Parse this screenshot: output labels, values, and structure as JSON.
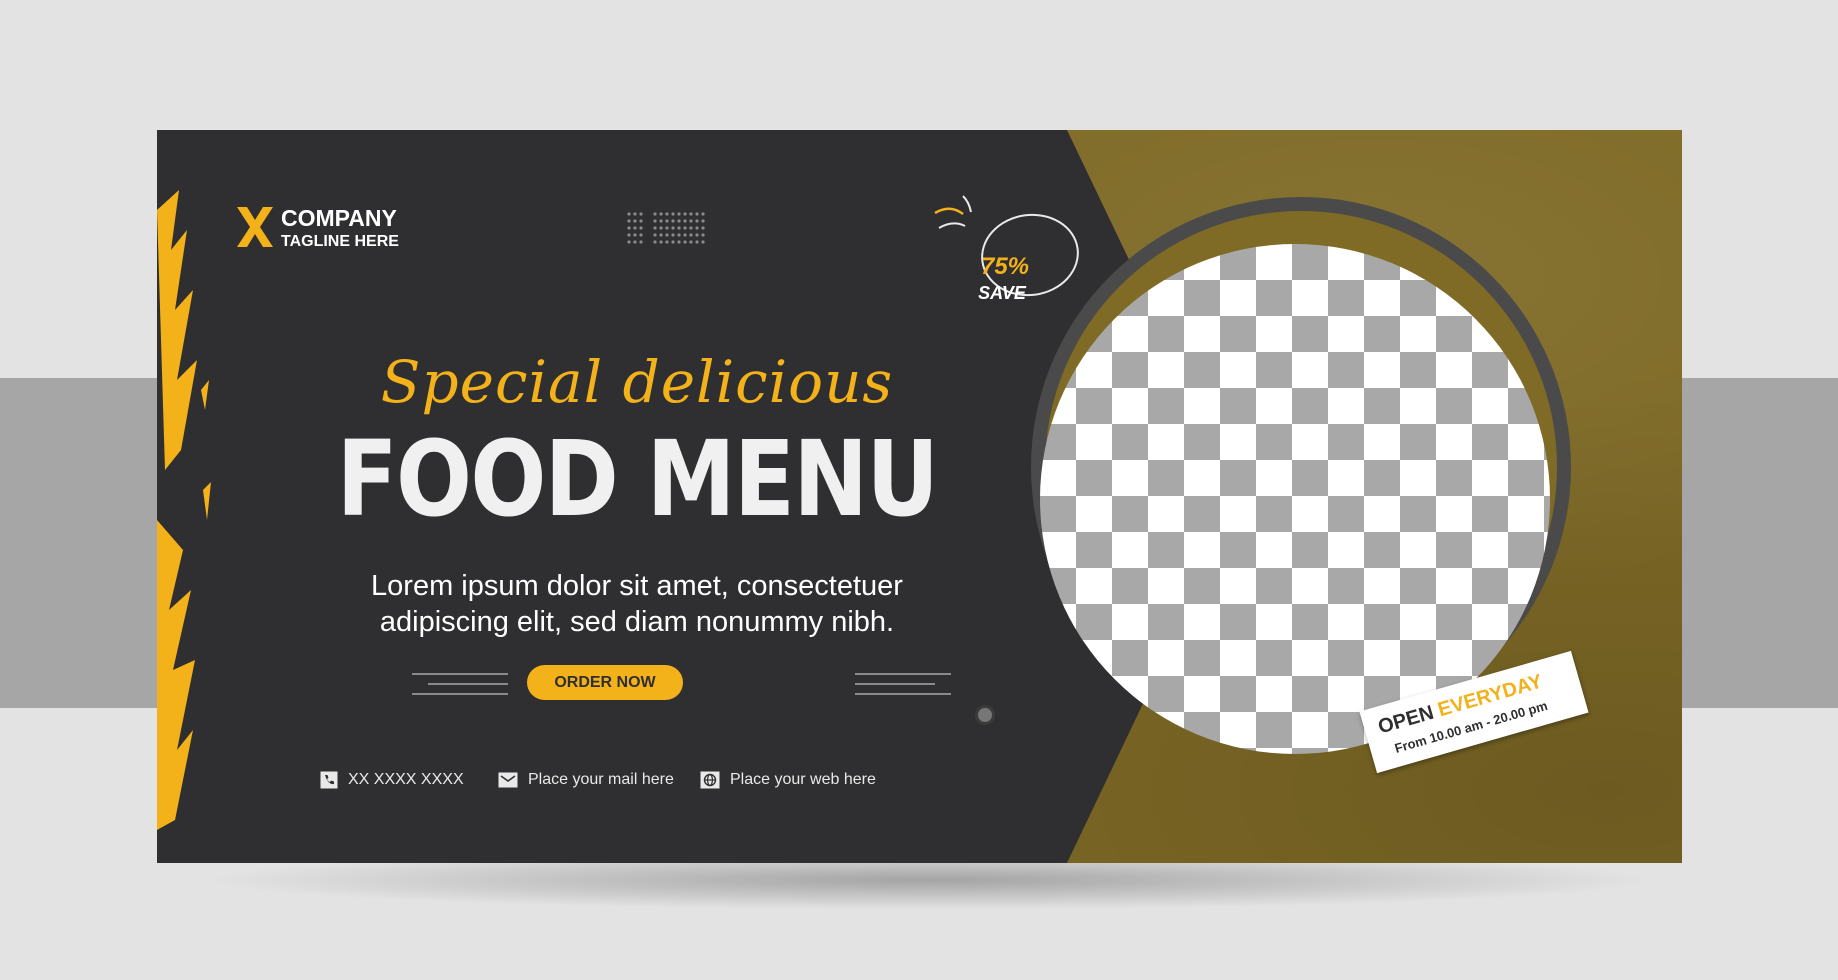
{
  "brand": {
    "company": "COMPANY",
    "tagline": "TAGLINE HERE",
    "logo_icon": "x-logo-icon",
    "accent_color": "#f3b11a",
    "dark_color": "#2f2f31",
    "olive_color": "#7f6a26"
  },
  "headline": {
    "script": "Special delicious",
    "main": "FOOD MENU"
  },
  "description": {
    "line1": "Lorem ipsum dolor sit amet, consectetuer",
    "line2": "adipiscing elit, sed diam nonummy nibh."
  },
  "order_button": {
    "label": "ORDER NOW"
  },
  "badge": {
    "percent": "75%",
    "label": "SAVE"
  },
  "sticker": {
    "open": "OPEN",
    "everyday": "EVERYDAY",
    "hours": "From 10.00 am - 20.00 pm"
  },
  "contacts": [
    {
      "icon": "phone-icon",
      "text": "XX XXXX XXXX"
    },
    {
      "icon": "mail-icon",
      "text": "Place your mail here"
    },
    {
      "icon": "globe-icon",
      "text": "Place your web here"
    }
  ]
}
